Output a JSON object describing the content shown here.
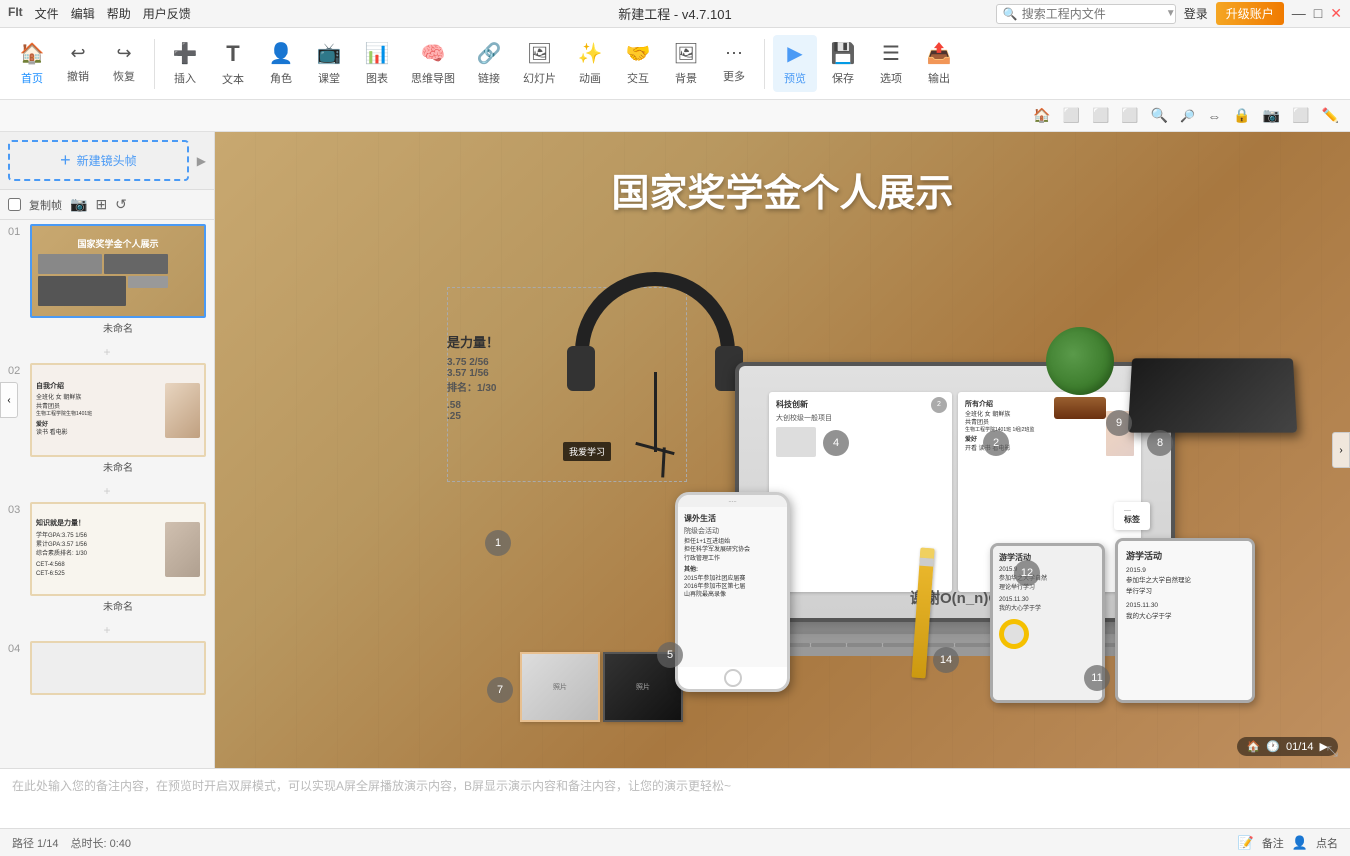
{
  "app": {
    "title": "新建工程 - v4.7.101",
    "logo_text": "FIt"
  },
  "titlebar": {
    "menus": [
      "文件",
      "编辑",
      "帮助",
      "用户反馈"
    ],
    "search_placeholder": "搜索工程内文件",
    "login_label": "登录",
    "upgrade_label": "升级账户",
    "win_min": "—",
    "win_max": "□",
    "win_close": "✕"
  },
  "toolbar": {
    "items": [
      {
        "id": "home",
        "icon": "🏠",
        "label": "首页"
      },
      {
        "id": "undo",
        "icon": "↩",
        "label": "撤销"
      },
      {
        "id": "redo",
        "icon": "↪",
        "label": "恢复"
      },
      {
        "id": "insert",
        "icon": "➕",
        "label": "插入"
      },
      {
        "id": "text",
        "icon": "T",
        "label": "文本"
      },
      {
        "id": "role",
        "icon": "👤",
        "label": "角色"
      },
      {
        "id": "class",
        "icon": "📺",
        "label": "课堂"
      },
      {
        "id": "chart",
        "icon": "📊",
        "label": "图表"
      },
      {
        "id": "mindmap",
        "icon": "🧠",
        "label": "思维导图"
      },
      {
        "id": "link",
        "icon": "🔗",
        "label": "链接"
      },
      {
        "id": "slide",
        "icon": "🖼",
        "label": "幻灯片"
      },
      {
        "id": "animate",
        "icon": "🎬",
        "label": "动画"
      },
      {
        "id": "interact",
        "icon": "🤝",
        "label": "交互"
      },
      {
        "id": "bg",
        "icon": "🖼",
        "label": "背景"
      },
      {
        "id": "more",
        "icon": "⋯",
        "label": "更多"
      },
      {
        "id": "preview",
        "icon": "▶",
        "label": "预览"
      },
      {
        "id": "save",
        "icon": "💾",
        "label": "保存"
      },
      {
        "id": "options",
        "icon": "☰",
        "label": "选项"
      },
      {
        "id": "export",
        "icon": "📤",
        "label": "输出"
      }
    ]
  },
  "icon_toolbar": {
    "icons": [
      "🏠",
      "⬜",
      "⬜",
      "⬜",
      "🔍",
      "🔍",
      "⇔",
      "🔒",
      "📷",
      "⬜",
      "✏️"
    ]
  },
  "sidebar": {
    "new_frame_label": "新建镜头帧",
    "tools": [
      "⬜",
      "📷",
      "⬜",
      "↺"
    ],
    "slides": [
      {
        "num": "01",
        "title": "未命名",
        "active": true,
        "content_type": "main",
        "bg_desc": "木桌背景+多设备"
      },
      {
        "num": "02",
        "title": "未命名",
        "active": false,
        "content_type": "profile",
        "text_lines": [
          "自我介绍",
          "全班化 女 朝鲜族",
          "共青团员",
          "生物工程学院生物1401班 1组|2班监",
          "爱好",
          "请开电影 看电影"
        ]
      },
      {
        "num": "03",
        "title": "未命名",
        "active": false,
        "content_type": "knowledge",
        "text_lines": [
          "知识就是力量！",
          "学年GPA:3.75  1/56",
          "累计GPA:3.57  1/56",
          "综合素质排名: 1/30",
          "",
          "CET-4:568",
          "CET-6:525"
        ]
      },
      {
        "num": "04",
        "title": "未命名",
        "active": false,
        "content_type": "blank"
      }
    ]
  },
  "canvas": {
    "title": "国家奖学金个人展示",
    "numbered_items": [
      {
        "num": "1",
        "left": "275",
        "top": "398"
      },
      {
        "num": "2",
        "left": "770",
        "top": "300"
      },
      {
        "num": "4",
        "left": "610",
        "top": "300"
      },
      {
        "num": "5",
        "left": "445",
        "top": "512"
      },
      {
        "num": "7",
        "left": "275",
        "top": "547"
      },
      {
        "num": "8",
        "left": "935",
        "top": "300"
      },
      {
        "num": "9",
        "left": "1082",
        "top": "280"
      },
      {
        "num": "11",
        "left": "1100",
        "top": "535"
      },
      {
        "num": "12",
        "left": "1035",
        "top": "430"
      },
      {
        "num": "14",
        "left": "720",
        "top": "517"
      }
    ],
    "laptop_text": "谢谢O(n_n)O",
    "phone_card": {
      "title": "课外生活",
      "subtitle": "院级会活动",
      "content": "担任1+1互进组始\n担任科学军发展研究协会\n行政管理工作\n\n其他:\n2015年参加社团应届赛\n2016年参加市区第七届题\n山再院最高录像"
    },
    "laptop_card": {
      "title": "科技创新",
      "subtitle": "大创校级一般项目",
      "num_badge": "2"
    },
    "profile_card": {
      "label": "所有介绍",
      "name": "全班化 女 朝鲜族",
      "detail1": "共青团员",
      "detail2": "生物工程学院生物1401班 1组|2班监",
      "label2": "爱好",
      "detail3": "开看 读书 看电影"
    },
    "knowledge_text": "知识就是力量！",
    "knowledge_stats": [
      "3.75   2/56",
      "3.57   1/56",
      "排名：1/30"
    ],
    "knowledge_scores": [
      ".58",
      ".25"
    ],
    "activity_title": "游学活动",
    "activity_lines": [
      "2015.9",
      "参加华之大学自然理论举行学习",
      "2015.11.30",
      "我的大心学于学"
    ],
    "frame_counter": "01/14"
  },
  "bottom": {
    "notes_placeholder": "在此处输入您的备注内容，在预览时开启双屏模式，可以实现A屏全屏播放演示内容，B屏显示演示内容和备注内容，让您的演示更轻松~",
    "status_path": "路径 1/14",
    "status_duration": "总时长: 0:40",
    "notes_label": "备注",
    "points_label": "点名"
  }
}
